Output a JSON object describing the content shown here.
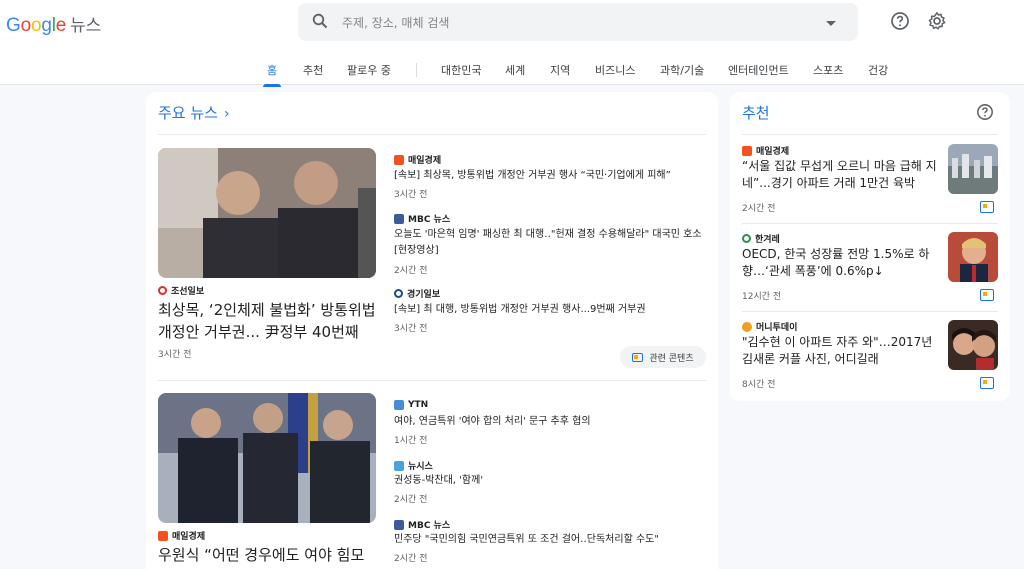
{
  "header": {
    "logo_letters": [
      "G",
      "o",
      "o",
      "g",
      "l",
      "e"
    ],
    "logo_service": "뉴스",
    "search_placeholder": "주제, 장소, 매체 검색",
    "help_icon": "help-icon",
    "settings_icon": "gear-icon"
  },
  "nav": {
    "tabs": [
      {
        "label": "홈",
        "active": true
      },
      {
        "label": "추천"
      },
      {
        "label": "팔로우 중"
      },
      {
        "label": "대한민국"
      },
      {
        "label": "세계"
      },
      {
        "label": "지역"
      },
      {
        "label": "비즈니스"
      },
      {
        "label": "과학/기술"
      },
      {
        "label": "엔터테인먼트"
      },
      {
        "label": "스포츠"
      },
      {
        "label": "건강"
      }
    ]
  },
  "main": {
    "title": "주요 뉴스",
    "stories": [
      {
        "lead_source": "조선일보",
        "lead_headline": "최상목, ‘2인체제 불법화’ 방통위법 개정안 거부권... 尹정부 40번째",
        "lead_time": "3시간 전",
        "related": [
          {
            "source": "매일경제",
            "headline": "[속보] 최상목, 방통위법 개정안 거부권 행사 “국민·기업에게 피해”",
            "time": "3시간 전"
          },
          {
            "source": "MBC 뉴스",
            "headline": "오늘도 '마은혁 임명' 패싱한 최 대행‥\"헌재 결정 수용해달라\" 대국민 호소 [현장영상]",
            "time": "2시간 전"
          },
          {
            "source": "경기일보",
            "headline": "[속보] 최 대행, 방통위법 개정안 거부권 행사...9번째 거부권",
            "time": "3시간 전"
          }
        ],
        "related_button": "관련 콘텐츠"
      },
      {
        "lead_source": "매일경제",
        "lead_headline": "우원식 “어떤 경우에도 여야 힘모",
        "related": [
          {
            "source": "YTN",
            "headline": "여야, 연금특위 '여야 합의 처리' 문구 추후 협의",
            "time": "1시간 전"
          },
          {
            "source": "뉴시스",
            "headline": "권성동-박찬대, '함께'",
            "time": "2시간 전"
          },
          {
            "source": "MBC 뉴스",
            "headline": "민주당 \"국민의힘 국민연금특위 또 조건 걸어‥단독처리할 수도\"",
            "time": "2시간 전"
          }
        ]
      }
    ]
  },
  "side": {
    "title": "추천",
    "items": [
      {
        "source": "매일경제",
        "headline": "“서울 집값 무섭게 오르니 마음 급해 지네”...경기 아파트 거래 1만건 육박",
        "time": "2시간 전"
      },
      {
        "source": "한겨레",
        "headline": "OECD, 한국 성장률 전망 1.5%로 하향…‘관세 폭풍’에 0.6%p↓",
        "time": "12시간 전"
      },
      {
        "source": "머니투데이",
        "headline": "\"김수현 이 아파트 자주 와\"…2017년 김새론 커플 사진, 어디길래",
        "time": "8시간 전"
      }
    ]
  },
  "colors": {
    "accent": "#1a73e8",
    "maeil": "#f4511e",
    "mbc": "#3c5a99",
    "chosun": "#d93025",
    "ytn": "#4a8bd6",
    "newsis": "#4aa3df"
  }
}
